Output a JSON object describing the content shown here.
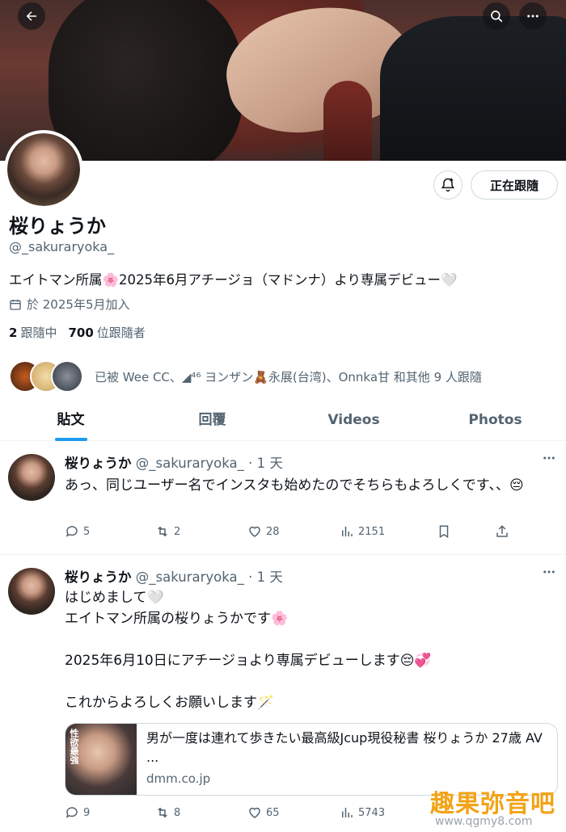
{
  "profile": {
    "name": "桜りょうか",
    "handle": "@_sakuraryoka_",
    "bio": "エイトマン所属🌸2025年6月アチージョ（マドンナ）より専属デビュー🤍",
    "joined": "於 2025年5月加入",
    "following_count": "2",
    "following_label": "跟隨中",
    "followers_count": "700",
    "followers_label": "位跟隨者",
    "followed_by": "已被 Wee CC、◢⁴⁶ ヨンザン🧸永展(台湾)、Onnka甘 和其他 9 人跟隨",
    "follow_button": "正在跟隨"
  },
  "tabs": [
    "貼文",
    "回覆",
    "Videos",
    "Photos"
  ],
  "posts": [
    {
      "name": "桜りょうか",
      "meta": "@_sakuraryoka_ · 1 天",
      "text": "あっ、同じユーザー名でインスタも始めたのでそちらもよろしくです、、😔",
      "replies": "5",
      "reposts": "2",
      "likes": "28",
      "views": "2151"
    },
    {
      "name": "桜りょうか",
      "meta": "@_sakuraryoka_ · 1 天",
      "text": "はじめまして🤍\nエイトマン所属の桜りょうかです🌸\n\n2025年6月10日にアチージョより専属デビューします😔💞\n\nこれからよろしくお願いします🪄",
      "card_title": "男が一度は連れて歩きたい最高級Jcup現役秘書 桜りょうか 27歳 AV ...",
      "card_domain": "dmm.co.jp",
      "card_thumb_text": "性欲最強",
      "replies": "9",
      "reposts": "8",
      "likes": "65",
      "views": "5743"
    }
  ],
  "watermark": {
    "text": "趣果弥音吧",
    "url": "www.qgmy8.com"
  },
  "colors": {
    "accent": "#1d9bf0",
    "secondary_text": "#536471",
    "watermark": "#f2a316"
  }
}
